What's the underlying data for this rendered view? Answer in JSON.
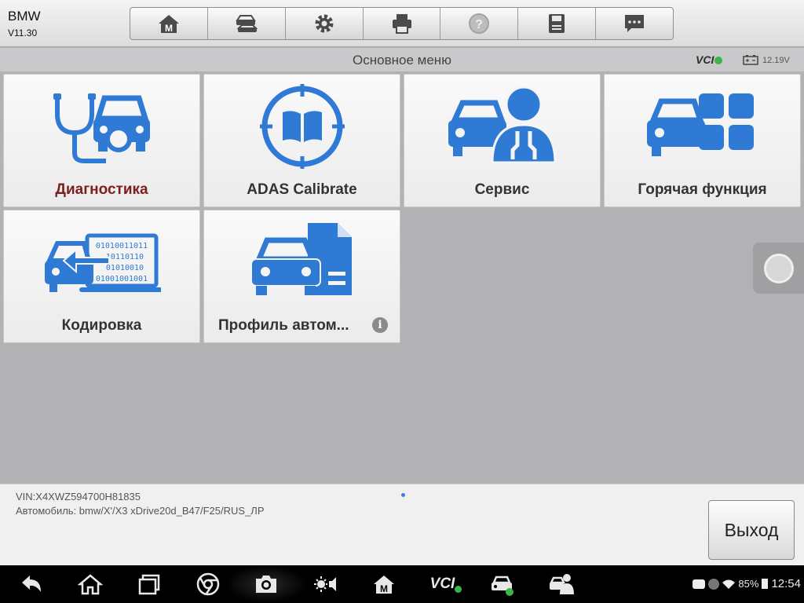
{
  "header": {
    "brand_name": "BMW",
    "version": "V11.30",
    "toolbar": [
      {
        "name": "home-icon"
      },
      {
        "name": "vehicle-swap-icon"
      },
      {
        "name": "gear-icon"
      },
      {
        "name": "printer-icon"
      },
      {
        "name": "help-icon"
      },
      {
        "name": "save-icon"
      },
      {
        "name": "message-icon"
      }
    ]
  },
  "titlebar": {
    "title": "Основное меню",
    "vci_label": "VCI",
    "voltage": "12.19V"
  },
  "tiles": {
    "diagnostics": {
      "label": "Диагностика",
      "icon": "stethoscope-car-icon"
    },
    "adas": {
      "label": "ADAS Calibrate",
      "icon": "adas-book-target-icon"
    },
    "service": {
      "label": "Сервис",
      "icon": "car-mechanic-icon"
    },
    "hot": {
      "label": "Горячая функция",
      "icon": "car-grid-icon"
    },
    "coding": {
      "label": "Кодировка",
      "icon": "car-binary-code-icon"
    },
    "profile": {
      "label": "Профиль автом...",
      "icon": "car-document-icon",
      "info_glyph": "i"
    }
  },
  "footer": {
    "vin": "VIN:X4XWZ594700H81835",
    "vehicle": "Автомобиль: bmw/X'/X3 xDrive20d_B47/F25/RUS_ЛР",
    "exit_label": "Выход"
  },
  "navbar": {
    "items": [
      "back-icon",
      "home-icon",
      "recents-icon",
      "chrome-icon",
      "camera-icon",
      "brightness-volume-icon",
      "maxisys-home-icon",
      "vci-icon",
      "car-check-icon",
      "mechanic-icon"
    ],
    "vci_text": "VCI",
    "battery": "85%",
    "time": "12:54"
  },
  "colors": {
    "accent_blue": "#2f7ad4",
    "diagnostics_label": "#7d1e1e",
    "ok_green": "#39b54a"
  }
}
